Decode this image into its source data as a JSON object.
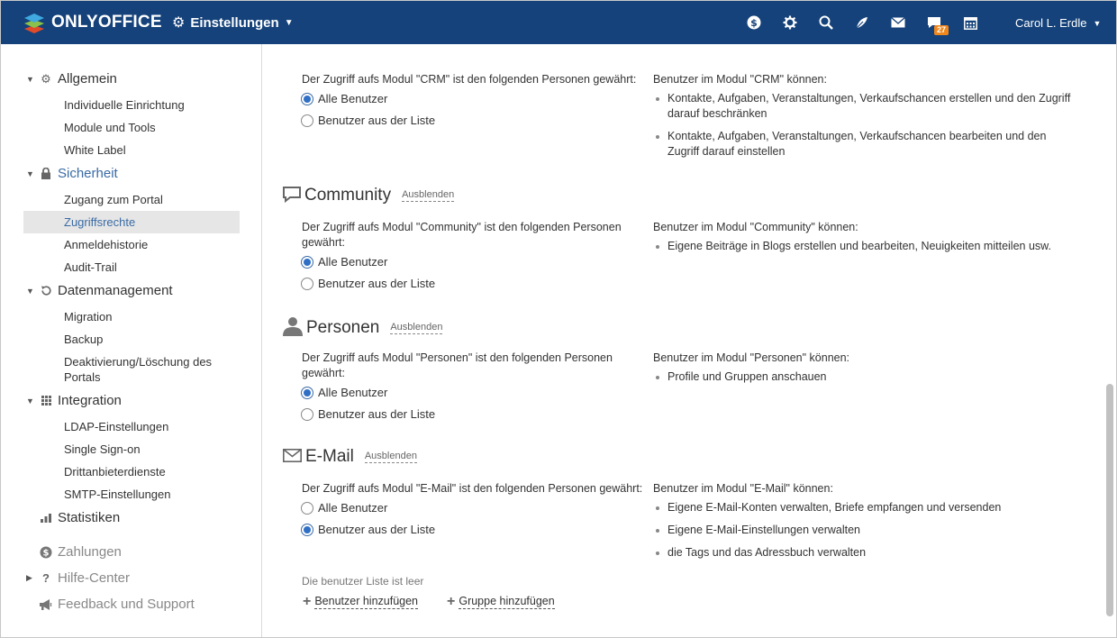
{
  "header": {
    "logo_text": "ONLYOFFICE",
    "module_name": "Einstellungen",
    "badge_count": "27",
    "user_name": "Carol L. Erdle",
    "icons": [
      "payments-icon",
      "settings-icon",
      "search-icon",
      "feed-icon",
      "mail-icon",
      "chat-icon",
      "calendar-icon"
    ],
    "colors": {
      "bar": "#15427a",
      "badge": "#f0871d"
    }
  },
  "sidebar": {
    "sections": [
      {
        "label": "Allgemein",
        "icon": "gear-icon",
        "items": [
          "Individuelle Einrichtung",
          "Module und Tools",
          "White Label"
        ]
      },
      {
        "label": "Sicherheit",
        "icon": "lock-icon",
        "items": [
          "Zugang zum Portal",
          "Zugriffsrechte",
          "Anmeldehistorie",
          "Audit-Trail"
        ]
      },
      {
        "label": "Datenmanagement",
        "icon": "restore-icon",
        "items": [
          "Migration",
          "Backup",
          "Deaktivierung/Löschung des Portals"
        ]
      },
      {
        "label": "Integration",
        "icon": "grid-icon",
        "items": [
          "LDAP-Einstellungen",
          "Single Sign-on",
          "Drittanbieterdienste",
          "SMTP-Einstellungen"
        ]
      },
      {
        "label": "Statistiken",
        "icon": "stats-icon"
      },
      {
        "label": "Zahlungen",
        "icon": "dollar-icon"
      },
      {
        "label": "Hilfe-Center",
        "icon": "help-icon"
      },
      {
        "label": "Feedback und Support",
        "icon": "megaphone-icon"
      }
    ],
    "selected_item": "Zugriffsrechte"
  },
  "modules": {
    "crm": {
      "access_text": "Der Zugriff aufs Modul \"CRM\" ist den folgenden Personen gewährt:",
      "option_all": "Alle Benutzer",
      "option_list": "Benutzer aus der Liste",
      "selected": "all",
      "rights_title": "Benutzer im Modul \"CRM\" können:",
      "rights": [
        "Kontakte, Aufgaben, Veranstaltungen, Verkaufschancen erstellen und den Zugriff darauf beschränken",
        "Kontakte, Aufgaben, Veranstaltungen, Verkaufschancen bearbeiten und den Zugriff darauf einstellen"
      ]
    },
    "community": {
      "title": "Community",
      "hide_label": "Ausblenden",
      "access_text": "Der Zugriff aufs Modul \"Community\" ist den folgenden Personen gewährt:",
      "option_all": "Alle Benutzer",
      "option_list": "Benutzer aus der Liste",
      "selected": "all",
      "rights_title": "Benutzer im Modul \"Community\" können:",
      "rights": [
        "Eigene Beiträge in Blogs erstellen und bearbeiten, Neuigkeiten mitteilen usw."
      ]
    },
    "people": {
      "title": "Personen",
      "hide_label": "Ausblenden",
      "access_text": "Der Zugriff aufs Modul \"Personen\" ist den folgenden Personen gewährt:",
      "option_all": "Alle Benutzer",
      "option_list": "Benutzer aus der Liste",
      "selected": "all",
      "rights_title": "Benutzer im Modul \"Personen\" können:",
      "rights": [
        "Profile und Gruppen anschauen"
      ]
    },
    "mail": {
      "title": "E-Mail",
      "hide_label": "Ausblenden",
      "access_text": "Der Zugriff aufs Modul \"E-Mail\" ist den folgenden Personen gewährt:",
      "option_all": "Alle Benutzer",
      "option_list": "Benutzer aus der Liste",
      "selected": "list",
      "rights_title": "Benutzer im Modul \"E-Mail\" können:",
      "rights": [
        "Eigene E-Mail-Konten verwalten, Briefe empfangen und versenden",
        "Eigene E-Mail-Einstellungen verwalten",
        "die Tags und das Adressbuch verwalten"
      ],
      "empty_note": "Die benutzer Liste ist leer",
      "add_user": "Benutzer hinzufügen",
      "add_group": "Gruppe hinzufügen"
    }
  }
}
